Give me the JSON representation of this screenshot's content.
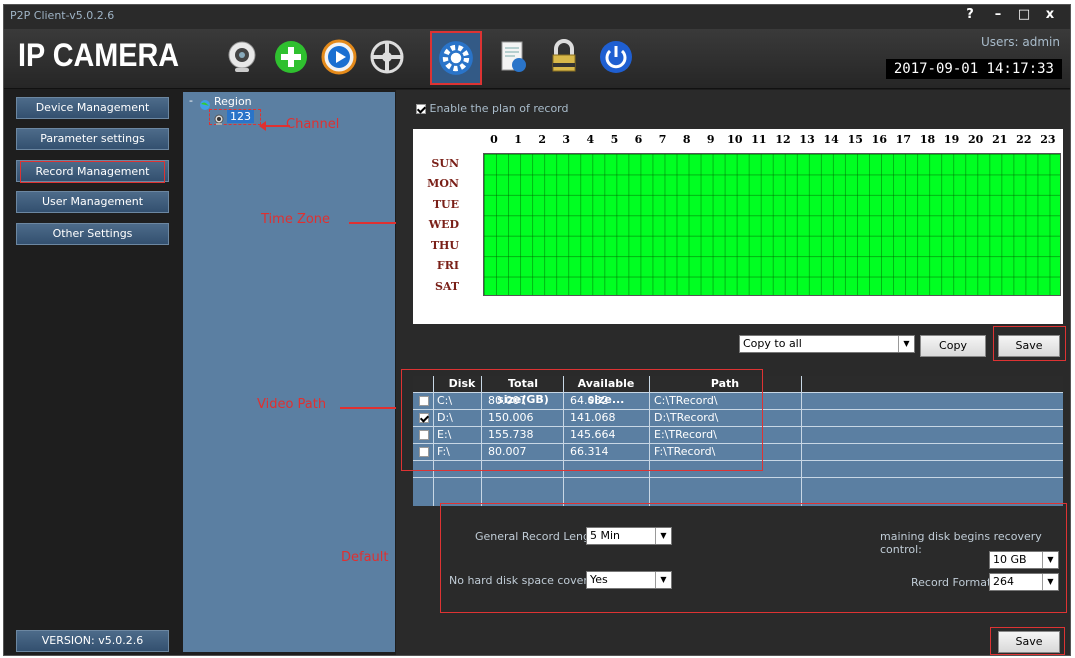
{
  "window": {
    "title": "P2P Client-v5.0.2.6",
    "help": "?",
    "minimize": "–",
    "maximize": "□",
    "close": "x"
  },
  "header": {
    "logo": "IP CAMERA",
    "user": "Users: admin",
    "datetime": "2017-09-01  14:17:33",
    "toolbar": [
      "webcam-icon",
      "add-icon",
      "playback-icon",
      "ptz-icon",
      "settings-icon",
      "log-icon",
      "lock-icon",
      "power-icon"
    ]
  },
  "sidebar": {
    "items": [
      {
        "label": "Device Management"
      },
      {
        "label": "Parameter settings"
      },
      {
        "label": "Record Management"
      },
      {
        "label": "User Management"
      },
      {
        "label": "Other Settings"
      }
    ],
    "version": "VERSION: v5.0.2.6"
  },
  "tree": {
    "root": "Region",
    "channel": "123"
  },
  "annotations": {
    "channel": "Channel",
    "time_zone": "Time Zone",
    "video_path": "Video Path",
    "default": "Default"
  },
  "schedule": {
    "enable_label": "Enable the plan of record",
    "enabled": true,
    "hours": [
      "0",
      "1",
      "2",
      "3",
      "4",
      "5",
      "6",
      "7",
      "8",
      "9",
      "10",
      "11",
      "12",
      "13",
      "14",
      "15",
      "16",
      "17",
      "18",
      "19",
      "20",
      "21",
      "22",
      "23"
    ],
    "days": [
      "SUN",
      "MON",
      "TUE",
      "WED",
      "THU",
      "FRI",
      "SAT"
    ],
    "copy_select": "Copy to all",
    "copy_label": "Copy",
    "save_label": "Save"
  },
  "disk_table": {
    "headers": [
      "Disk",
      "Total size(GB)",
      "Available size...",
      "Path"
    ],
    "rows": [
      {
        "checked": false,
        "disk": "C:\\",
        "total": "80.007",
        "available": "64.032",
        "path": "C:\\TRecord\\"
      },
      {
        "checked": true,
        "disk": "D:\\",
        "total": "150.006",
        "available": "141.068",
        "path": "D:\\TRecord\\"
      },
      {
        "checked": false,
        "disk": "E:\\",
        "total": "155.738",
        "available": "145.664",
        "path": "E:\\TRecord\\"
      },
      {
        "checked": false,
        "disk": "F:\\",
        "total": "80.007",
        "available": "66.314",
        "path": "F:\\TRecord\\"
      }
    ]
  },
  "record_settings": {
    "record_length_label": "General Record Length:",
    "record_length_value": "5 Min",
    "coverage_label": "No hard disk space coverage:",
    "coverage_value": "Yes",
    "recovery_label": "maining disk begins recovery control:",
    "recovery_value": "10 GB",
    "format_label": "Record Format:",
    "format_value": "264",
    "save_label": "Save"
  },
  "colors": {
    "accent": "#335a86",
    "grid_green": "#00ff22",
    "tree_bg": "#5b7fa2",
    "annotation": "#e03030"
  }
}
